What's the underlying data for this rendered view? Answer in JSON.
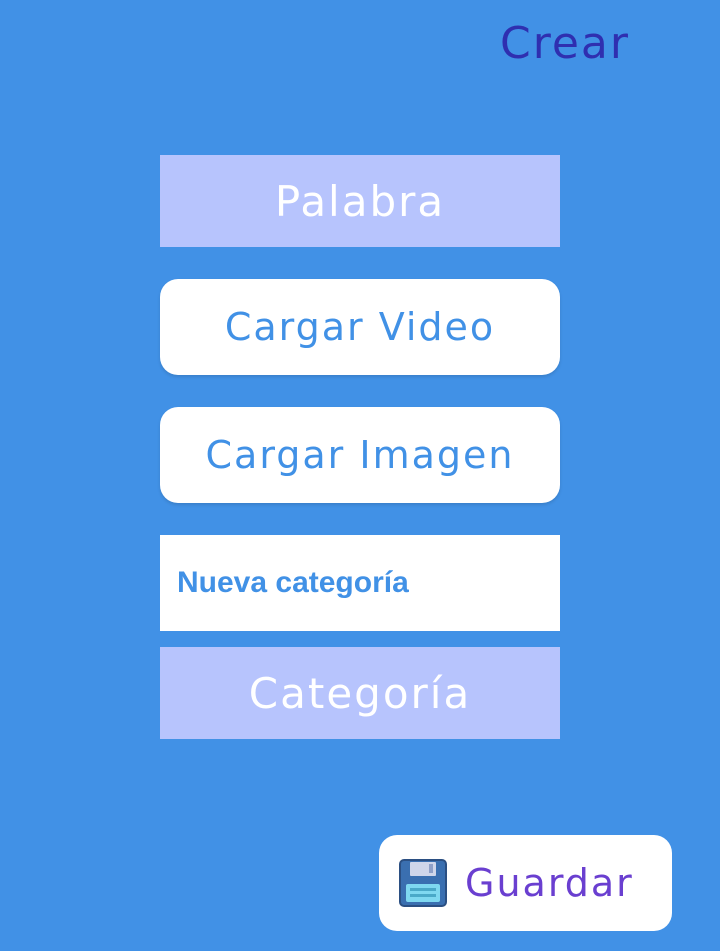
{
  "header": {
    "title": "Crear"
  },
  "form": {
    "word_field": "Palabra",
    "upload_video_label": "Cargar Video",
    "upload_image_label": "Cargar Imagen",
    "new_category_value": "Nueva categoría",
    "category_field": "Categoría"
  },
  "footer": {
    "save_label": "Guardar",
    "save_icon": "floppy-disk-icon"
  },
  "colors": {
    "background": "#4191e6",
    "field_purple": "#b7c4fd",
    "title": "#2f2fb0",
    "save_text": "#6a3fd0"
  }
}
